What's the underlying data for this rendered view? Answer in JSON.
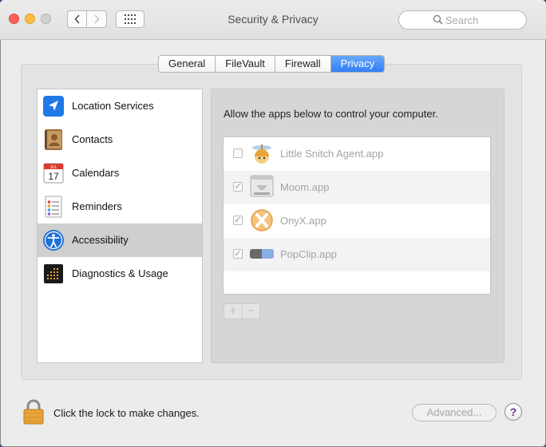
{
  "window": {
    "title": "Security & Privacy"
  },
  "toolbar": {
    "back_icon": "chevron-left-icon",
    "forward_icon": "chevron-right-icon",
    "grid_icon": "show-all-grid-icon"
  },
  "search": {
    "placeholder": "Search",
    "value": ""
  },
  "tabs": [
    {
      "label": "General",
      "active": false
    },
    {
      "label": "FileVault",
      "active": false
    },
    {
      "label": "Firewall",
      "active": false
    },
    {
      "label": "Privacy",
      "active": true
    }
  ],
  "sidebar": {
    "items": [
      {
        "label": "Location Services",
        "icon": "location-arrow-icon",
        "selected": false
      },
      {
        "label": "Contacts",
        "icon": "contacts-book-icon",
        "selected": false
      },
      {
        "label": "Calendars",
        "icon": "calendar-icon",
        "selected": false,
        "icon_text": {
          "month": "JUL",
          "day": "17"
        }
      },
      {
        "label": "Reminders",
        "icon": "reminders-list-icon",
        "selected": false
      },
      {
        "label": "Accessibility",
        "icon": "accessibility-icon",
        "selected": true
      },
      {
        "label": "Diagnostics & Usage",
        "icon": "diagnostics-grid-icon",
        "selected": false
      }
    ]
  },
  "main": {
    "heading": "Allow the apps below to control your computer.",
    "apps": [
      {
        "name": "Little Snitch Agent.app",
        "checked": false,
        "icon": "little-snitch-icon"
      },
      {
        "name": "Moom.app",
        "checked": true,
        "icon": "moom-icon"
      },
      {
        "name": "OnyX.app",
        "checked": true,
        "icon": "onyx-icon"
      },
      {
        "name": "PopClip.app",
        "checked": true,
        "icon": "popclip-icon"
      }
    ],
    "add_label": "+",
    "remove_label": "−"
  },
  "footer": {
    "lock_message": "Click the lock to make changes.",
    "advanced_label": "Advanced...",
    "help_label": "?"
  },
  "colors": {
    "accent": "#2f7ff6",
    "selected_row": "#cfcfcf",
    "close": "#fc605b",
    "minimize": "#fdbb40"
  }
}
